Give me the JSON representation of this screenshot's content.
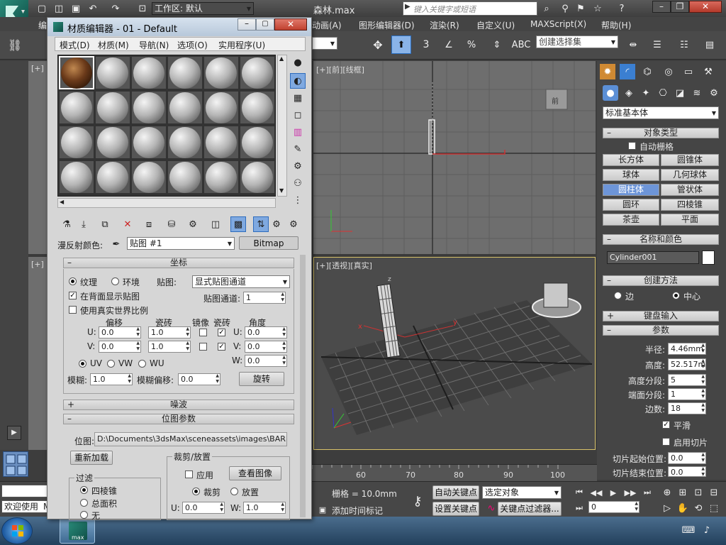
{
  "app": {
    "title": "森林.max",
    "workspace_label": "工作区: 默认",
    "search_placeholder": "键入关键字或短语"
  },
  "main_menu": [
    {
      "label": "动画(A)",
      "key": "animation"
    },
    {
      "label": "图形编辑器(D)",
      "key": "graph-editors"
    },
    {
      "label": "渲染(R)",
      "key": "rendering"
    },
    {
      "label": "自定义(U)",
      "key": "customize"
    },
    {
      "label": "MAXScript(X)",
      "key": "maxscript"
    },
    {
      "label": "帮助(H)",
      "key": "help"
    }
  ],
  "main_menu_partial": "编",
  "main_toolbar": {
    "selection_set": "创建选择集"
  },
  "viewports": {
    "front_label": "[+][前][线框]",
    "persp_label": "[+][透视][真实]",
    "left_plus": "[+]",
    "left_plus2": "[+]",
    "viewcube_label": "前",
    "axis_x": "x",
    "axis_y": "y",
    "axis_z": "z"
  },
  "timeline": {
    "ticks": [
      "60",
      "70",
      "80",
      "90",
      "100"
    ]
  },
  "status": {
    "grid": "栅格 = 10.0mm",
    "add_time_tag": "添加时间标记",
    "auto_key": "自动关键点",
    "set_key": "设置关键点",
    "key_mode": "选定对象",
    "key_filters": "关键点过滤器...",
    "frame": "0",
    "welcome": "欢迎使用",
    "welcome_suffix": "M"
  },
  "command_panel": {
    "category_dropdown": "标准基本体",
    "object_type": {
      "title": "对象类型",
      "auto_grid": "自动栅格",
      "buttons": [
        "长方体",
        "圆锥体",
        "球体",
        "几何球体",
        "圆柱体",
        "管状体",
        "圆环",
        "四棱锥",
        "茶壶",
        "平面"
      ],
      "active": "圆柱体"
    },
    "name_color": {
      "title": "名称和颜色",
      "name": "Cylinder001"
    },
    "creation_method": {
      "title": "创建方法",
      "edge": "边",
      "center": "中心"
    },
    "keyboard_entry": "键盘输入",
    "parameters": {
      "title": "参数",
      "radius_label": "半径:",
      "radius": "4.46mm",
      "height_label": "高度:",
      "height": "52.517mm",
      "height_segs_label": "高度分段:",
      "height_segs": "5",
      "cap_segs_label": "端面分段:",
      "cap_segs": "1",
      "sides_label": "边数:",
      "sides": "18",
      "smooth": "平滑",
      "slice_on": "启用切片",
      "slice_from_label": "切片起始位置:",
      "slice_from": "0.0",
      "slice_to_label": "切片结束位置:",
      "slice_to": "0.0"
    }
  },
  "material_editor": {
    "title": "材质编辑器 - 01 - Default",
    "menu": [
      "模式(D)",
      "材质(M)",
      "导航(N)",
      "选项(O)",
      "实用程序(U)"
    ],
    "diffuse_label": "漫反射颜色:",
    "map_name": "贴图 #1",
    "map_type": "Bitmap",
    "coords": {
      "title": "坐标",
      "texture": "纹理",
      "environ": "环境",
      "mapping_label": "贴图:",
      "mapping": "显式贴图通道",
      "show_map_on_back": "在背面显示贴图",
      "map_channel_label": "贴图通道:",
      "map_channel": "1",
      "real_world": "使用真实世界比例",
      "offset": "偏移",
      "tiling": "瓷砖",
      "mirror": "镜像",
      "tile": "瓷砖",
      "angle": "角度",
      "u_label": "U:",
      "v_label": "V:",
      "w_label": "W:",
      "u_offset": "0.0",
      "v_offset": "0.0",
      "u_tiling": "1.0",
      "v_tiling": "1.0",
      "u_angle": "0.0",
      "v_angle": "0.0",
      "w_angle": "0.0",
      "uv": "UV",
      "vw": "VW",
      "wu": "WU",
      "blur_label": "模糊:",
      "blur": "1.0",
      "blur_offset_label": "模糊偏移:",
      "blur_offset": "0.0",
      "rotate": "旋转"
    },
    "noise": "噪波",
    "bitmap_params": {
      "title": "位图参数",
      "bitmap_label": "位图:",
      "bitmap_path": "D:\\Documents\\3dsMax\\sceneassets\\images\\BARK5.jpg",
      "reload": "重新加载",
      "crop_group": "裁剪/放置",
      "apply": "应用",
      "view_image": "查看图像",
      "crop": "裁剪",
      "place": "放置",
      "u_label": "U:",
      "u": "0.0",
      "w_label": "W:",
      "w": "1.0",
      "filter_group": "过滤",
      "pyramidal": "四棱锥",
      "summed_area": "总面积",
      "none": "无"
    }
  },
  "taskbar": {
    "app_label": "max"
  },
  "colors": {
    "accent_blue": "#4a86d9",
    "bg_dark": "#3d3d3d",
    "viewport_gray": "#6e6e6e",
    "dialog_bg": "#d6d6d6"
  }
}
